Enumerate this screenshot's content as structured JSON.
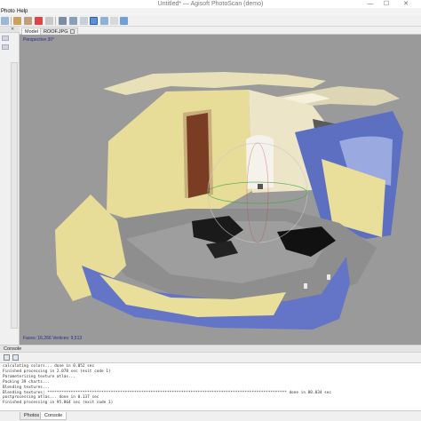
{
  "window": {
    "title": "Untitled* — Agisoft PhotoScan (demo)",
    "minimize": "—",
    "maximize": "☐",
    "close": "✕"
  },
  "menu": [
    "Photo",
    "Help"
  ],
  "view_tabs": [
    {
      "label": "Model",
      "active": true
    },
    {
      "label": "ROOF.JPG",
      "active": false
    }
  ],
  "viewport": {
    "projection_label": "Perspective 30°",
    "stats": "Faces: 16,266 Vertices: 9,513"
  },
  "console": {
    "title": "Console",
    "lines": [
      "calculating colors... done in 0.052 sec",
      "Finished processing in 2.078 sec (exit code 1)",
      "Parameterizing texture atlas...",
      "Packing 39 charts...",
      "Blending textures...",
      "Blending textures: ****************************************************************************************************** done in 80.034 sec",
      "postprocessing atlas... done in 0.137 sec",
      "Finished processing in 95.864 sec (exit code 1)"
    ]
  },
  "bottom_tabs": [
    {
      "label": "Photos",
      "active": false
    },
    {
      "label": "Console",
      "active": true
    }
  ],
  "colors": {
    "viewport_bg": "#9a9a9a",
    "wall_yellow": "#e9df9a",
    "wall_blue": "#5d6fc0",
    "floor_gray": "#8e8e8e",
    "door_brown": "#7a3d24"
  }
}
